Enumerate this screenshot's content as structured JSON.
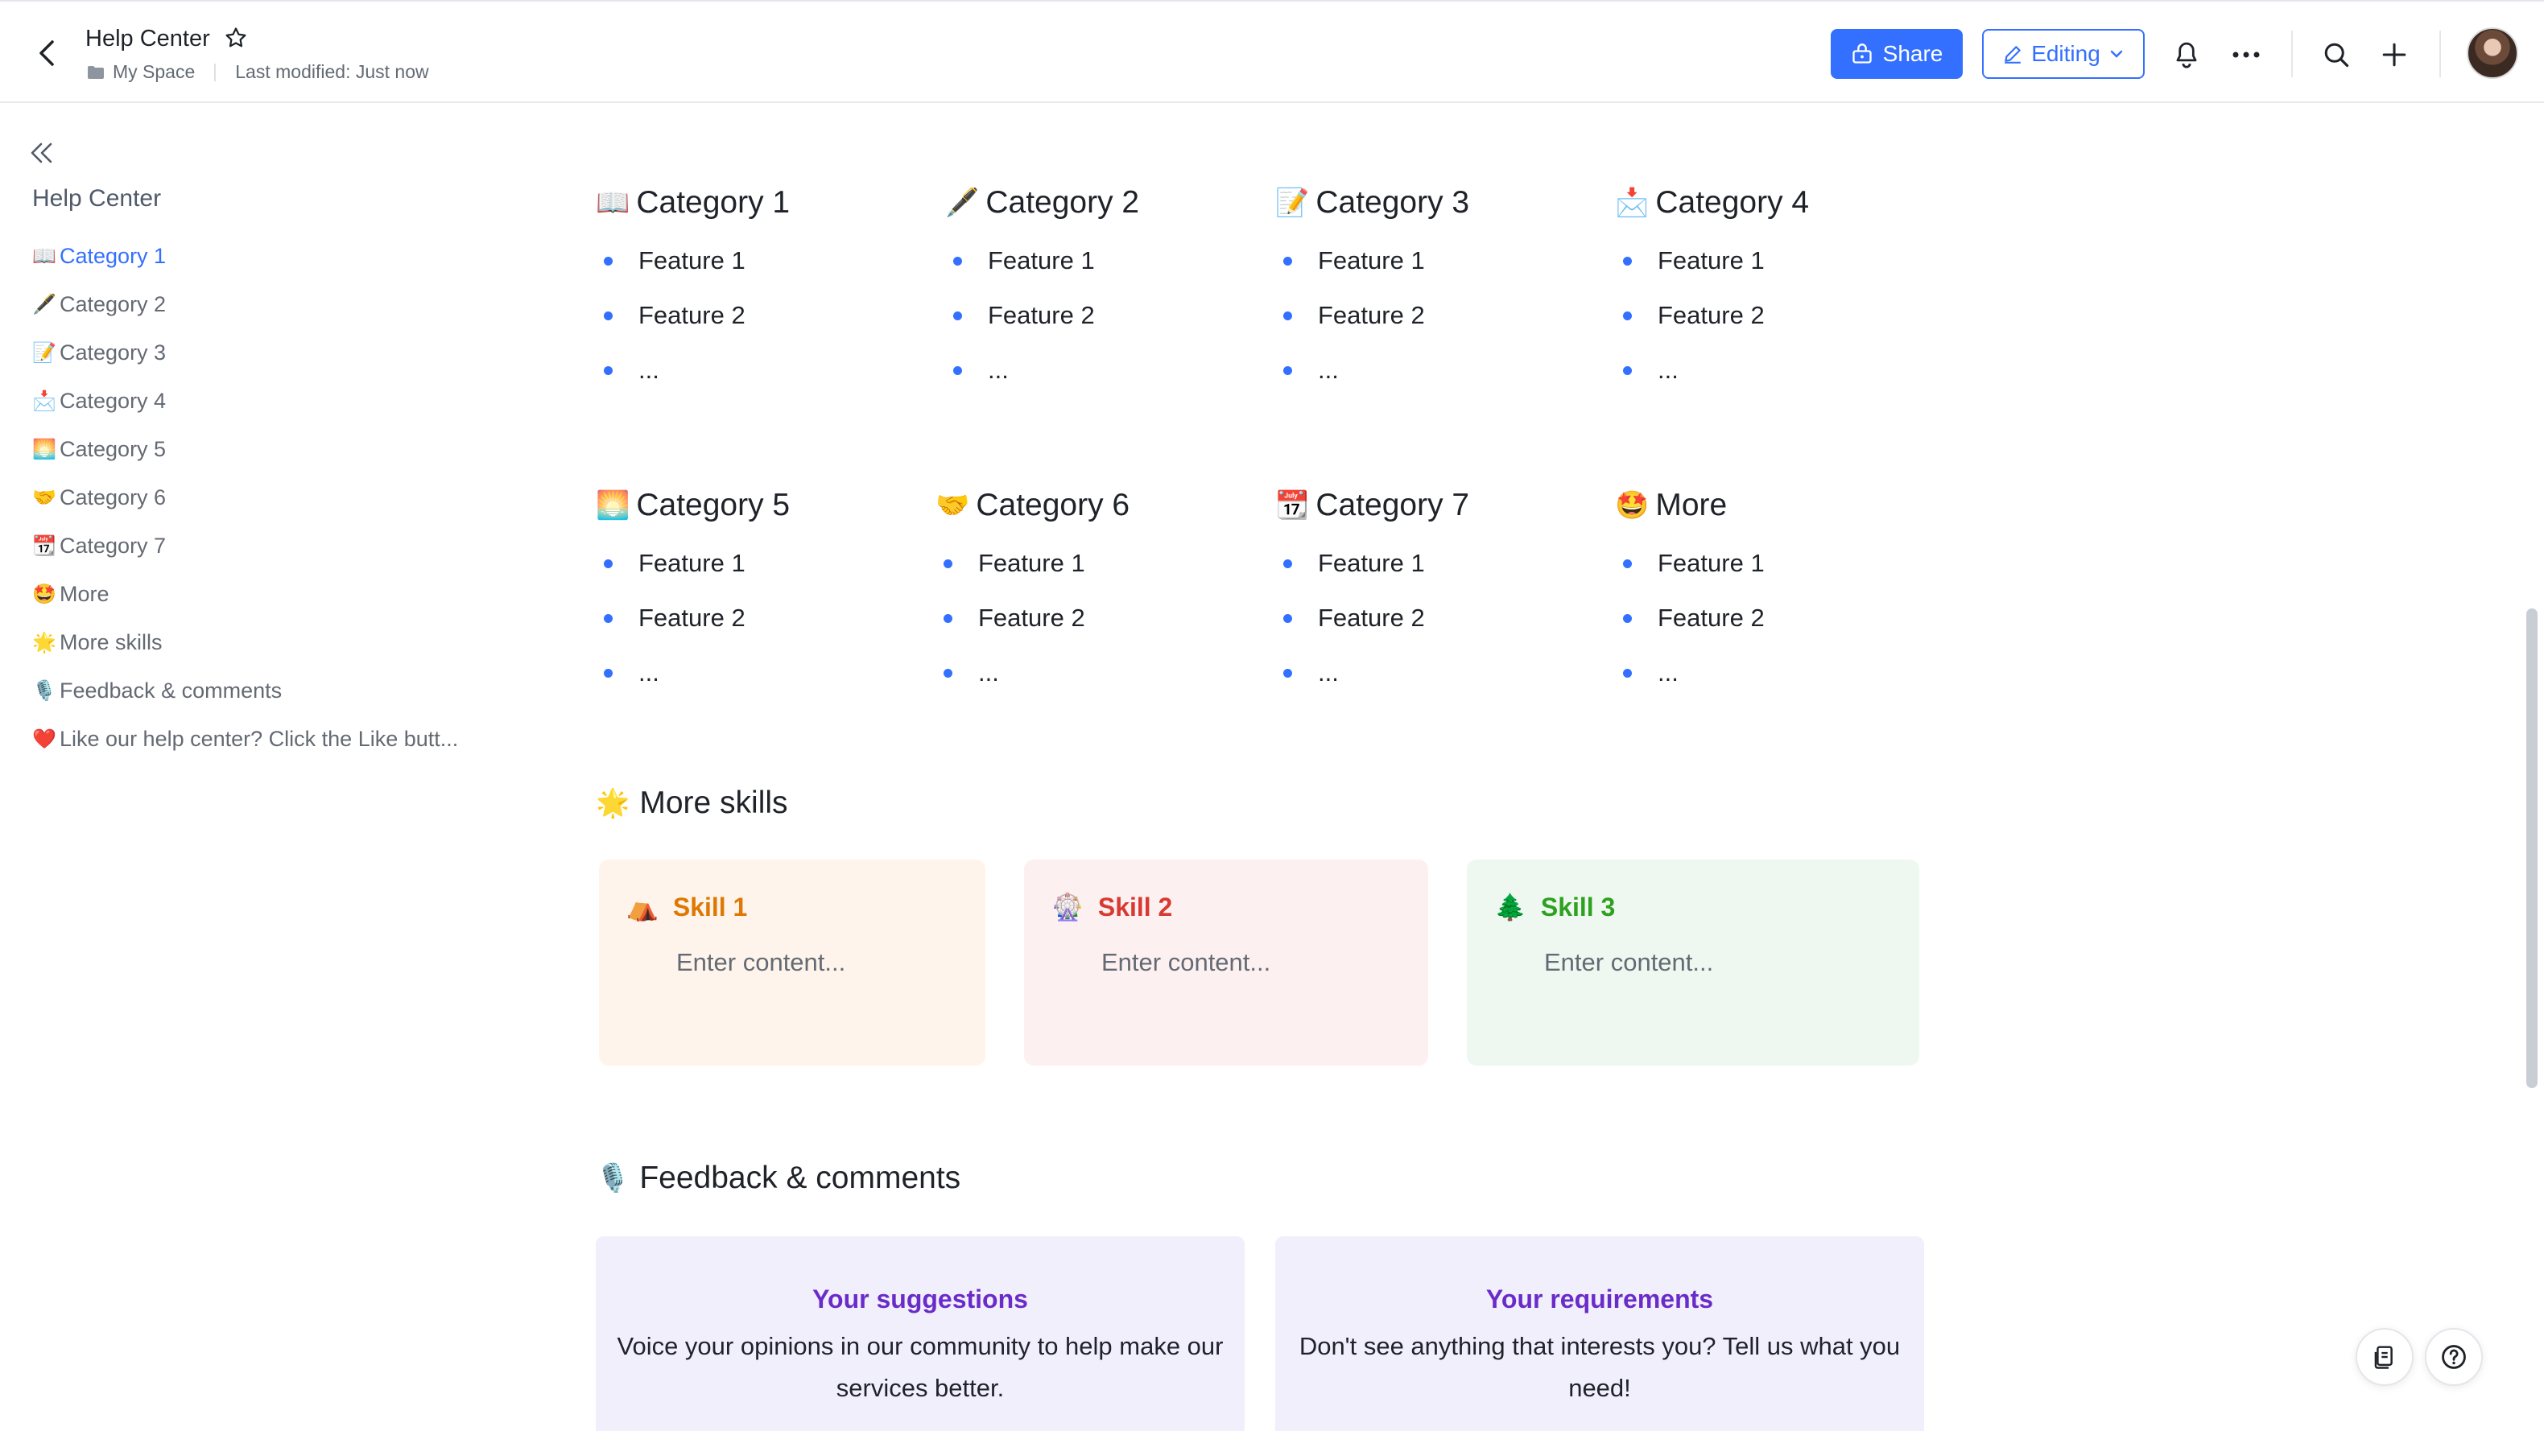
{
  "header": {
    "title": "Help Center",
    "breadcrumb_space": "My Space",
    "last_modified": "Last modified: Just now",
    "share_label": "Share",
    "editing_label": "Editing"
  },
  "sidebar": {
    "title": "Help Center",
    "items": [
      {
        "emoji": "📖",
        "label": "Category 1"
      },
      {
        "emoji": "🖋️",
        "label": "Category 2"
      },
      {
        "emoji": "📝",
        "label": "Category 3"
      },
      {
        "emoji": "📩",
        "label": "Category 4"
      },
      {
        "emoji": "🌅",
        "label": "Category 5"
      },
      {
        "emoji": "🤝",
        "label": "Category 6"
      },
      {
        "emoji": "📆",
        "label": "Category 7"
      },
      {
        "emoji": "🤩",
        "label": "More"
      },
      {
        "emoji": "🌟",
        "label": "More skills"
      },
      {
        "emoji": "🎙️",
        "label": "Feedback & comments"
      },
      {
        "emoji": "❤️",
        "label": "Like our help center? Click the Like butt..."
      }
    ]
  },
  "categories": [
    {
      "emoji": "📖",
      "title": "Category 1",
      "items": [
        "Feature 1",
        "Feature 2",
        "..."
      ]
    },
    {
      "emoji": "🖋️",
      "title": "Category 2",
      "items": [
        "Feature 1",
        "Feature 2",
        "..."
      ]
    },
    {
      "emoji": "📝",
      "title": "Category 3",
      "items": [
        "Feature 1",
        "Feature 2",
        "..."
      ]
    },
    {
      "emoji": "📩",
      "title": "Category 4",
      "items": [
        "Feature 1",
        "Feature 2",
        "..."
      ]
    },
    {
      "emoji": "🌅",
      "title": "Category 5",
      "items": [
        "Feature 1",
        "Feature 2",
        "..."
      ]
    },
    {
      "emoji": "🤝",
      "title": "Category 6",
      "items": [
        "Feature 1",
        "Feature 2",
        "..."
      ]
    },
    {
      "emoji": "📆",
      "title": "Category 7",
      "items": [
        "Feature 1",
        "Feature 2",
        "..."
      ]
    },
    {
      "emoji": "🤩",
      "title": "More",
      "items": [
        "Feature 1",
        "Feature 2",
        "..."
      ]
    }
  ],
  "more_skills": {
    "emoji": "🌟",
    "title": "More skills",
    "cards": [
      {
        "emoji": "⛺",
        "title": "Skill 1",
        "placeholder": "Enter content...",
        "bg": "#fef4eb",
        "color": "#de7802"
      },
      {
        "emoji": "🎡",
        "title": "Skill 2",
        "placeholder": "Enter content...",
        "bg": "#fdf0f0",
        "color": "#d83931"
      },
      {
        "emoji": "🌲",
        "title": "Skill 3",
        "placeholder": "Enter content...",
        "bg": "#eef8f0",
        "color": "#2ea121"
      }
    ]
  },
  "feedback": {
    "emoji": "🎙️",
    "title": "Feedback & comments",
    "cards": [
      {
        "title": "Your suggestions",
        "text": "Voice your opinions in our community to help make our services better."
      },
      {
        "title": "Your requirements",
        "text": "Don't see anything that interests you? Tell us what you need!"
      }
    ]
  },
  "colors": {
    "accent": "#3370ff",
    "feedback_title": "#6a2cc9"
  }
}
